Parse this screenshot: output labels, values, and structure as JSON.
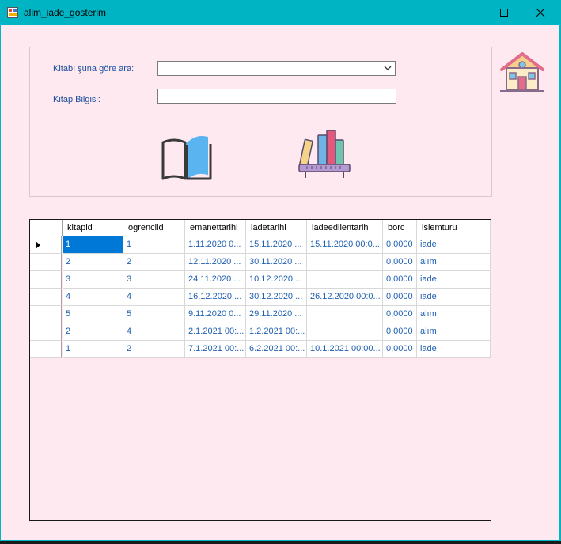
{
  "window": {
    "title": "alim_iade_gosterim"
  },
  "search": {
    "label": "Kitabı şuna göre ara:",
    "combo_value": ""
  },
  "info": {
    "label": "Kitap Bilgisi:",
    "value": ""
  },
  "icons": {
    "home": "home-icon",
    "open_book": "open-book-icon",
    "bookshelf": "bookshelf-icon"
  },
  "grid": {
    "columns": [
      "kitapid",
      "ogrenciid",
      "emanettarihi",
      "iadetarihi",
      "iadeedilentarih",
      "borc",
      "islemturu"
    ],
    "rows": [
      [
        "1",
        "1",
        "1.11.2020 0...",
        "15.11.2020 ...",
        "15.11.2020 00:0...",
        "0,0000",
        "iade"
      ],
      [
        "2",
        "2",
        "12.11.2020 ...",
        "30.11.2020 ...",
        "",
        "0,0000",
        "alım"
      ],
      [
        "3",
        "3",
        "24.11.2020 ...",
        "10.12.2020 ...",
        "",
        "0,0000",
        "iade"
      ],
      [
        "4",
        "4",
        "16.12.2020 ...",
        "30.12.2020 ...",
        "26.12.2020 00:0...",
        "0,0000",
        "iade"
      ],
      [
        "5",
        "5",
        "9.11.2020 0...",
        "29.11.2020 ...",
        "",
        "0,0000",
        "alım"
      ],
      [
        "2",
        "4",
        "2.1.2021 00:...",
        "1.2.2021 00:...",
        "",
        "0,0000",
        "alım"
      ],
      [
        "1",
        "2",
        "7.1.2021 00:...",
        "6.2.2021 00:...",
        "10.1.2021 00:00...",
        "0,0000",
        "iade"
      ]
    ]
  }
}
